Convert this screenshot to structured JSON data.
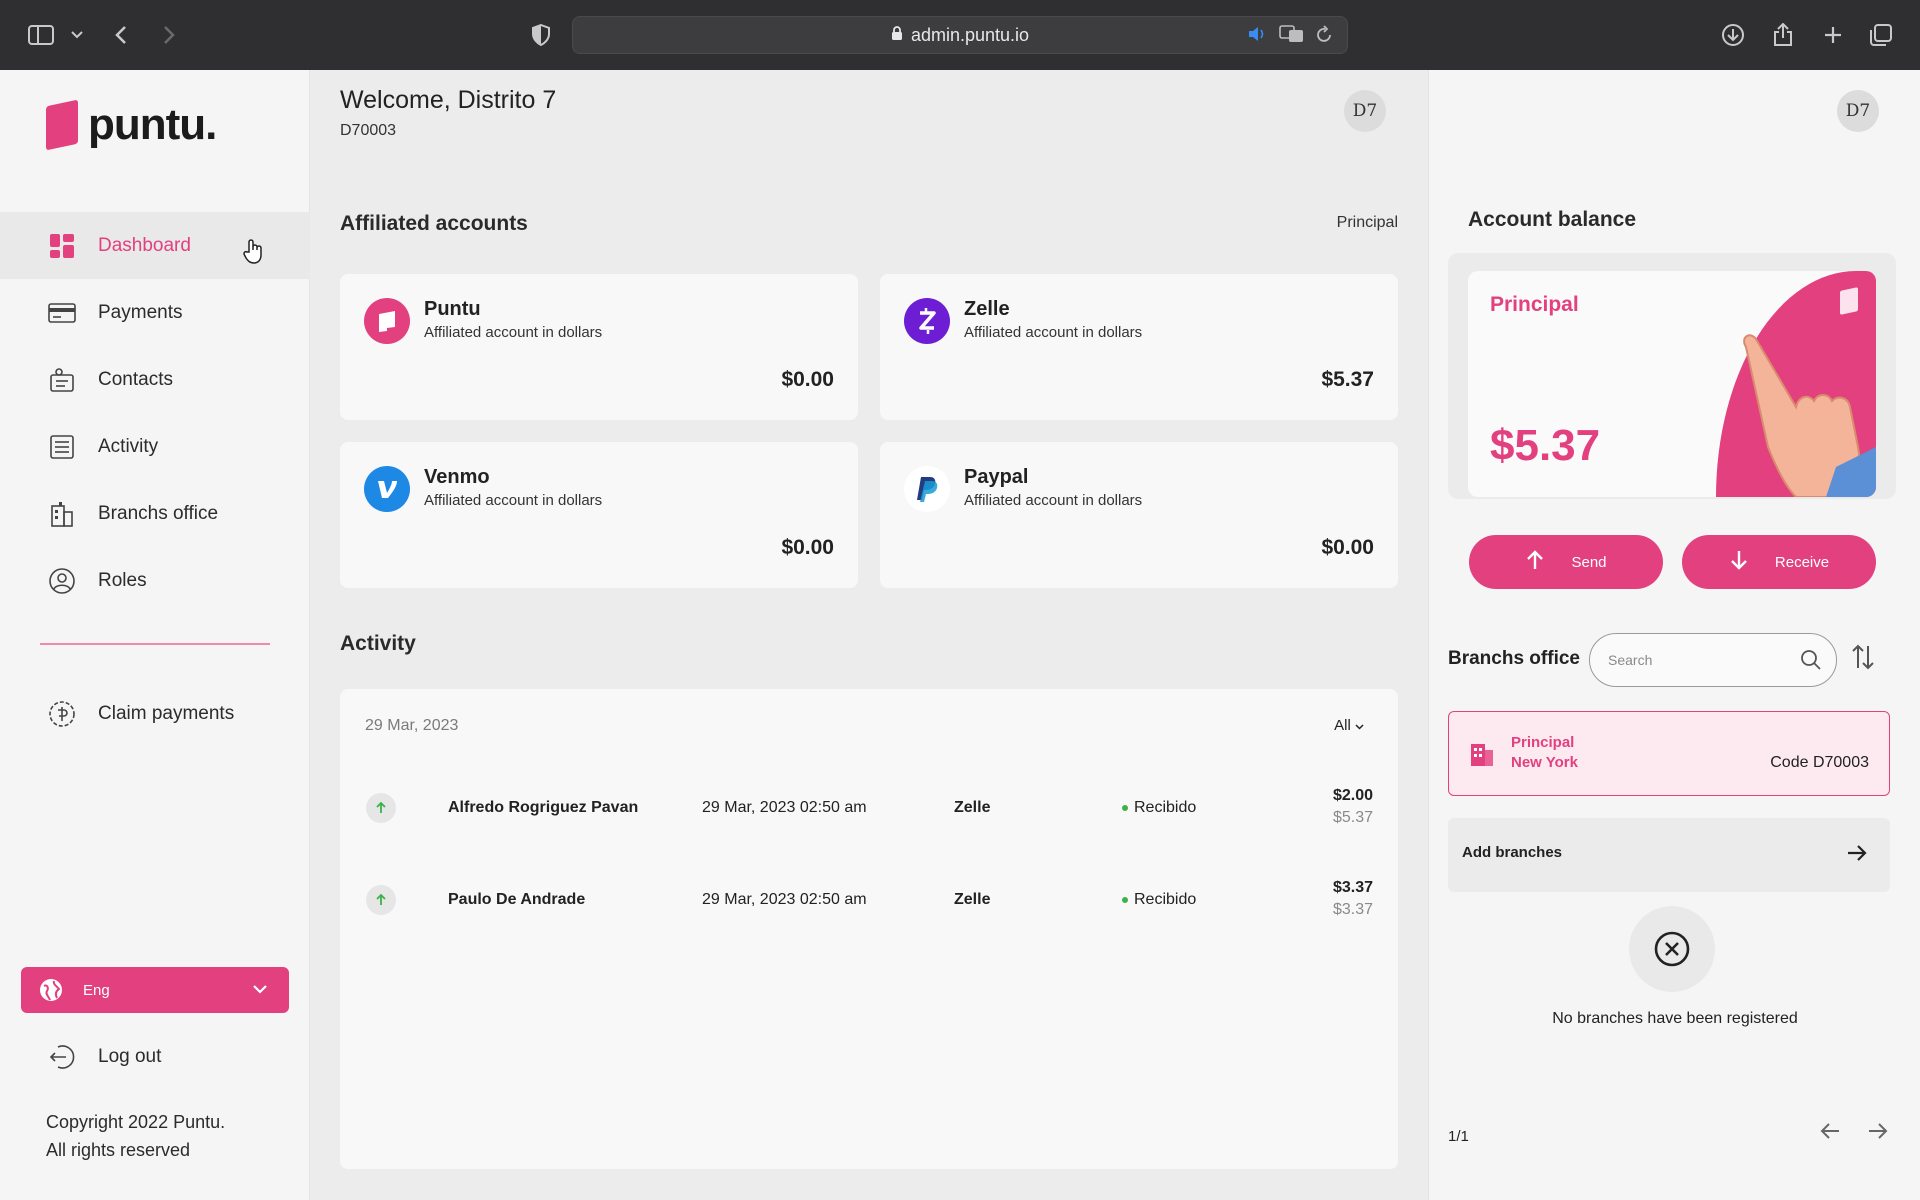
{
  "browser": {
    "url": "admin.puntu.io"
  },
  "sidebar": {
    "logo": "puntu.",
    "items": [
      {
        "label": "Dashboard",
        "icon": "dashboard-icon",
        "active": true
      },
      {
        "label": "Payments",
        "icon": "card-icon"
      },
      {
        "label": "Contacts",
        "icon": "contacts-icon"
      },
      {
        "label": "Activity",
        "icon": "activity-icon"
      },
      {
        "label": "Branchs office",
        "icon": "building-icon"
      },
      {
        "label": "Roles",
        "icon": "roles-icon"
      }
    ],
    "claim": "Claim payments",
    "language": "Eng",
    "logout": "Log out",
    "copyright_1": "Copyright 2022 Puntu.",
    "copyright_2": "All rights reserved"
  },
  "header": {
    "welcome": "Welcome, Distrito 7",
    "code": "D70003",
    "avatar": "D7"
  },
  "affiliated": {
    "title": "Affiliated accounts",
    "link": "Principal",
    "accounts": [
      {
        "name": "Puntu",
        "sub": "Affiliated account in dollars",
        "amount": "$0.00",
        "color": "#e2407f"
      },
      {
        "name": "Zelle",
        "sub": "Affiliated account in dollars",
        "amount": "$5.37",
        "color": "#6d1ed4"
      },
      {
        "name": "Venmo",
        "sub": "Affiliated account in dollars",
        "amount": "$0.00",
        "color": "#1e88e5"
      },
      {
        "name": "Paypal",
        "sub": "Affiliated account in dollars",
        "amount": "$0.00",
        "color": "#253b80"
      }
    ]
  },
  "activity": {
    "title": "Activity",
    "date": "29 Mar, 2023",
    "filter": "All",
    "rows": [
      {
        "name": "Alfredo Rogriguez Pavan",
        "when": "29 Mar, 2023 02:50 am",
        "via": "Zelle",
        "status": "Recibido",
        "amount": "$2.00",
        "balance": "$5.37"
      },
      {
        "name": "Paulo De Andrade",
        "when": "29 Mar, 2023 02:50 am",
        "via": "Zelle",
        "status": "Recibido",
        "amount": "$3.37",
        "balance": "$3.37"
      }
    ]
  },
  "right": {
    "avatar": "D7",
    "balance_title": "Account balance",
    "card_label": "Principal",
    "balance": "$5.37",
    "send": "Send",
    "receive": "Receive",
    "branches_title": "Branchs office",
    "search_placeholder": "Search",
    "branch": {
      "name": "Principal",
      "city": "New York",
      "code": "Code D70003"
    },
    "add_branches": "Add branches",
    "empty": "No branches have been registered",
    "pager": "1/1"
  },
  "colors": {
    "accent": "#e2407f",
    "success": "#3bb24a"
  }
}
